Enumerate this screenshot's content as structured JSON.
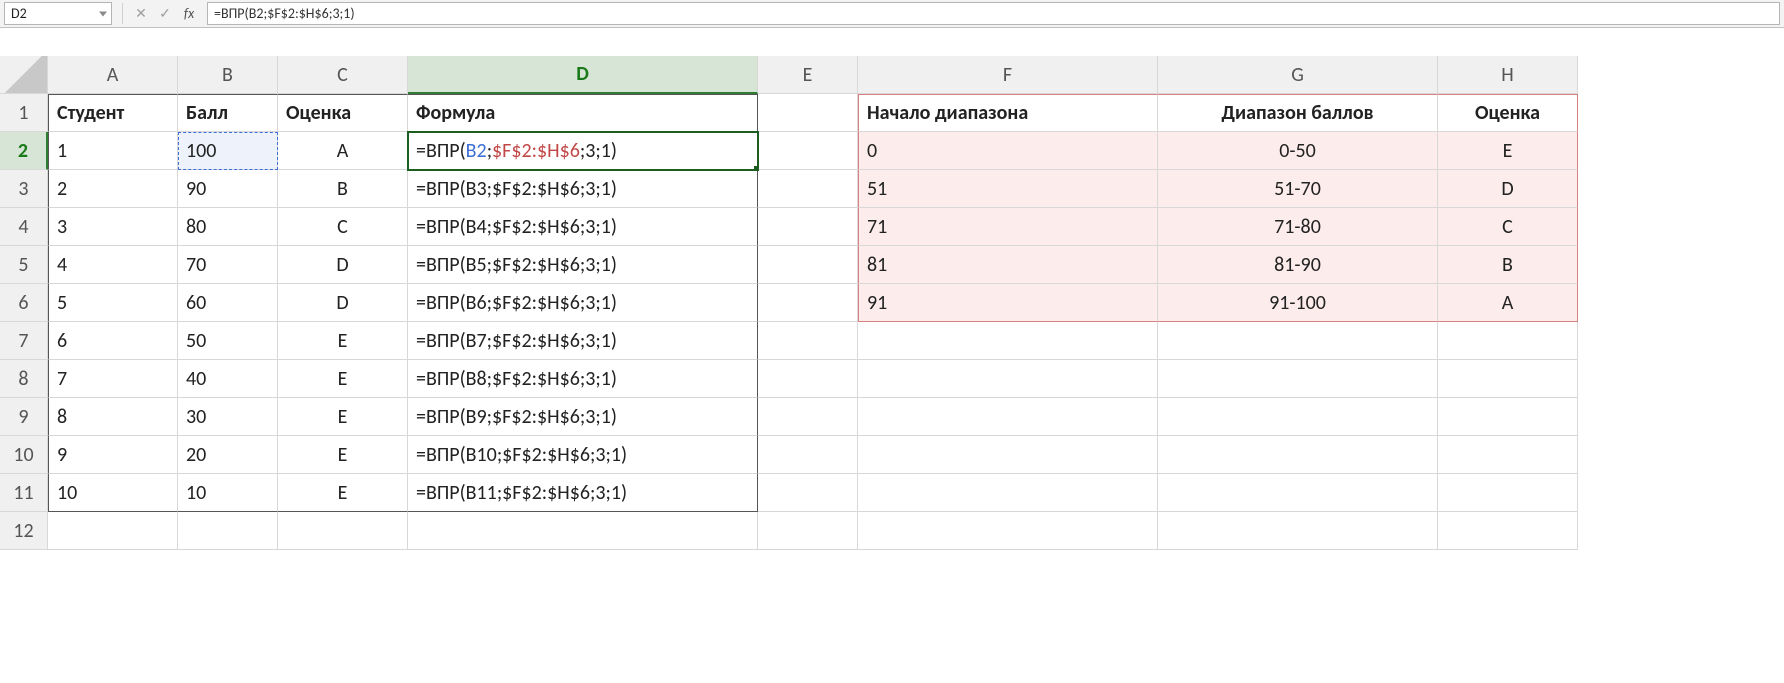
{
  "namebox": "D2",
  "fx_label": "fx",
  "cancel_glyph": "✕",
  "accept_glyph": "✓",
  "formula_bar": "=ВПР(B2;$F$2:$H$6;3;1)",
  "columns": [
    "A",
    "B",
    "C",
    "D",
    "E",
    "F",
    "G",
    "H"
  ],
  "row_numbers": [
    "1",
    "2",
    "3",
    "4",
    "5",
    "6",
    "7",
    "8",
    "9",
    "10",
    "11",
    "12"
  ],
  "headers": {
    "A": "Студент",
    "B": "Балл",
    "C": "Оценка",
    "D": "Формула",
    "F": "Начало диапазона",
    "G": "Диапазон баллов",
    "H": "Оценка"
  },
  "student_rows": [
    {
      "student": "1",
      "score": "100",
      "grade": "A",
      "formula": "=ВПР(B2;$F$2:$H$6;3;1)"
    },
    {
      "student": "2",
      "score": "90",
      "grade": "B",
      "formula": "=ВПР(B3;$F$2:$H$6;3;1)"
    },
    {
      "student": "3",
      "score": "80",
      "grade": "C",
      "formula": "=ВПР(B4;$F$2:$H$6;3;1)"
    },
    {
      "student": "4",
      "score": "70",
      "grade": "D",
      "formula": "=ВПР(B5;$F$2:$H$6;3;1)"
    },
    {
      "student": "5",
      "score": "60",
      "grade": "D",
      "formula": "=ВПР(B6;$F$2:$H$6;3;1)"
    },
    {
      "student": "6",
      "score": "50",
      "grade": "E",
      "formula": "=ВПР(B7;$F$2:$H$6;3;1)"
    },
    {
      "student": "7",
      "score": "40",
      "grade": "E",
      "formula": "=ВПР(B8;$F$2:$H$6;3;1)"
    },
    {
      "student": "8",
      "score": "30",
      "grade": "E",
      "formula": "=ВПР(B9;$F$2:$H$6;3;1)"
    },
    {
      "student": "9",
      "score": "20",
      "grade": "E",
      "formula": "=ВПР(B10;$F$2:$H$6;3;1)"
    },
    {
      "student": "10",
      "score": "10",
      "grade": "E",
      "formula": "=ВПР(B11;$F$2:$H$6;3;1)"
    }
  ],
  "lookup_rows": [
    {
      "start": "0",
      "range": "0-50",
      "grade": "E"
    },
    {
      "start": "51",
      "range": "51-70",
      "grade": "D"
    },
    {
      "start": "71",
      "range": "71-80",
      "grade": "C"
    },
    {
      "start": "81",
      "range": "81-90",
      "grade": "B"
    },
    {
      "start": "91",
      "range": "91-100",
      "grade": "A"
    }
  ],
  "d2_formula_parts": {
    "p1": "=ВПР(",
    "p2": "B2",
    "p3": ";",
    "p4": "$F$2:$H$6",
    "p5": ";3;1)"
  }
}
